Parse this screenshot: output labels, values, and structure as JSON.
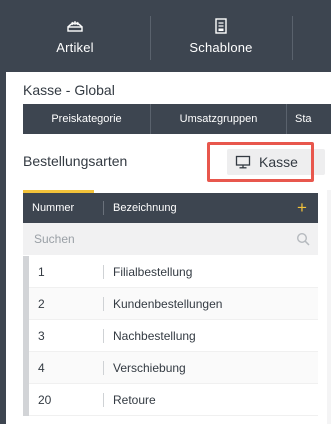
{
  "nav": {
    "items": [
      {
        "label": "Artikel",
        "icon": "bread-icon"
      },
      {
        "label": "Schablone",
        "icon": "document-icon"
      }
    ]
  },
  "panel": {
    "title": "Kasse - Global",
    "tabs": [
      "Preiskategorie",
      "Umsatzgruppen",
      "Sta"
    ]
  },
  "section": {
    "title": "Bestellungsarten",
    "kasse_button": {
      "label": "Kasse",
      "icon": "monitor-icon"
    },
    "highlight_color": "#e8574d"
  },
  "table": {
    "columns": [
      "Nummer",
      "Bezeichnung"
    ],
    "add_icon": "plus-icon",
    "search": {
      "placeholder": "Suchen",
      "value": ""
    },
    "rows": [
      {
        "nummer": "1",
        "bezeichnung": "Filialbestellung"
      },
      {
        "nummer": "2",
        "bezeichnung": "Kundenbestellungen"
      },
      {
        "nummer": "3",
        "bezeichnung": "Nachbestellung"
      },
      {
        "nummer": "4",
        "bezeichnung": "Verschiebung"
      },
      {
        "nummer": "20",
        "bezeichnung": "Retoure"
      }
    ]
  },
  "colors": {
    "nav_bg": "#3d4550",
    "accent": "#f2c23a"
  }
}
